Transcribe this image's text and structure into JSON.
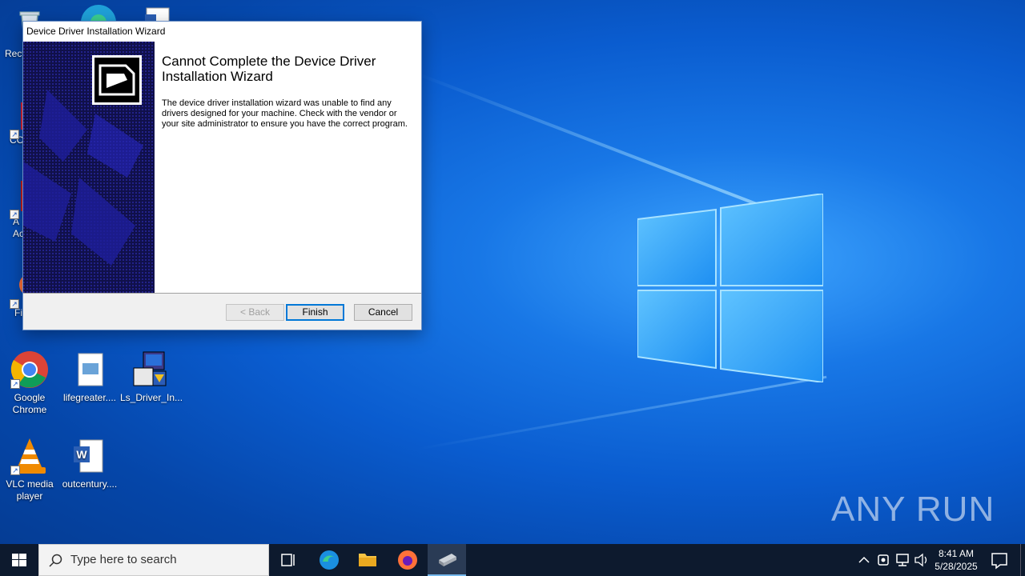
{
  "desktop": {
    "icons": [
      {
        "id": "recycle",
        "label": "Recy"
      },
      {
        "id": "ccleaner",
        "label": "CC"
      },
      {
        "id": "acrobat",
        "label": "A\nAc"
      },
      {
        "id": "firefox",
        "label": "Fi"
      },
      {
        "id": "chrome",
        "label": "Google\nChrome"
      },
      {
        "id": "lifegreater",
        "label": "lifegreater...."
      },
      {
        "id": "ls_driver",
        "label": "Ls_Driver_In..."
      },
      {
        "id": "vlc",
        "label": "VLC media\nplayer"
      },
      {
        "id": "outcentury",
        "label": "outcentury...."
      }
    ],
    "watermark": "ANY RUN"
  },
  "dialog": {
    "title": "Device Driver Installation Wizard",
    "heading": "Cannot Complete the Device Driver Installation Wizard",
    "body": "The device driver installation wizard was unable to find any drivers designed for your machine.  Check with the vendor or your site administrator to ensure you have the correct program.",
    "buttons": {
      "back": "< Back",
      "finish": "Finish",
      "cancel": "Cancel"
    }
  },
  "taskbar": {
    "search_placeholder": "Type here to search",
    "clock_time": "8:41 AM",
    "clock_date": "5/28/2025"
  },
  "colors": {
    "accent": "#0078d7",
    "taskbar": "#0d1a2e",
    "wizard_side": "#1a1a5c"
  }
}
